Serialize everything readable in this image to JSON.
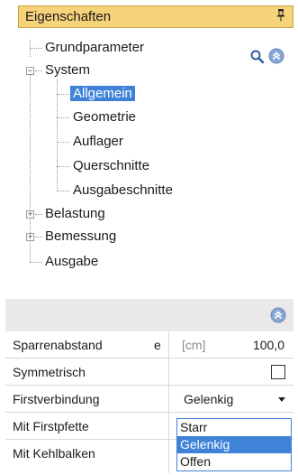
{
  "panel": {
    "title": "Eigenschaften",
    "pin_glyph": "I"
  },
  "icons": {
    "search": "search-icon",
    "collapse": "collapse-up-icon",
    "pin": "pin-icon"
  },
  "colors": {
    "title_bg": "#f6d27a",
    "selection": "#3f83d9",
    "header_bg": "#e9e9e9"
  },
  "tree": {
    "grundparameter": "Grundparameter",
    "system": "System",
    "allgemein": "Allgemein",
    "geometrie": "Geometrie",
    "auflager": "Auflager",
    "querschnitte": "Querschnitte",
    "ausgabeschnitte": "Ausgabeschnitte",
    "belastung": "Belastung",
    "bemessung": "Bemessung",
    "ausgabe": "Ausgabe",
    "selected": "Allgemein"
  },
  "properties": {
    "sparrenabstand": {
      "label": "Sparrenabstand",
      "symbol": "e",
      "unit": "[cm]",
      "value": "100,0"
    },
    "symmetrisch": {
      "label": "Symmetrisch",
      "checked": false
    },
    "firstverbindung": {
      "label": "Firstverbindung",
      "value": "Gelenkig"
    },
    "mit_firstpfette": {
      "label": "Mit Firstpfette"
    },
    "mit_kehlbalken": {
      "label": "Mit Kehlbalken"
    }
  },
  "dropdown": {
    "options": [
      "Starr",
      "Gelenkig",
      "Offen"
    ],
    "selected": "Gelenkig"
  }
}
